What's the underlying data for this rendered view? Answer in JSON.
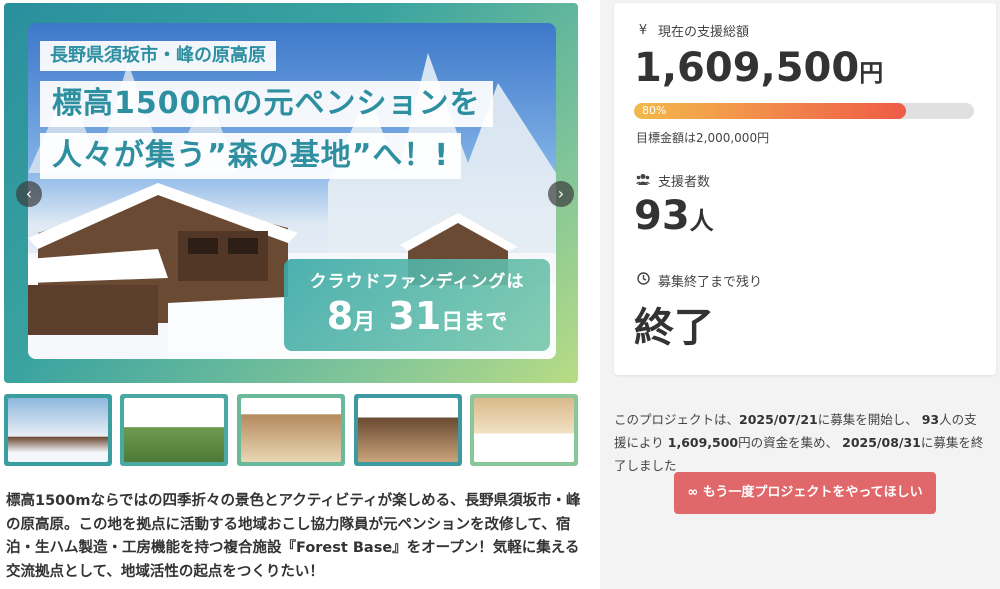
{
  "hero": {
    "caption_line1": "長野県須坂市・峰の原高原",
    "caption_line2": "標高1500ｍの元ペンションを",
    "caption_line3": "人々が集う”森の基地”へ！!",
    "deadline_line1": "クラウドファンディングは",
    "deadline_month": "8",
    "deadline_month_unit": "月",
    "deadline_day": "31",
    "deadline_day_unit": "日まで",
    "prev_icon": "chevron-left-icon",
    "next_icon": "chevron-right-icon"
  },
  "thumbnails": [
    {
      "name": "thumb-1",
      "color": "#3a9e9e"
    },
    {
      "name": "thumb-2",
      "color": "#4aa9a2"
    },
    {
      "name": "thumb-3",
      "color": "#6ab99a"
    },
    {
      "name": "thumb-4",
      "color": "#3d9aa1"
    },
    {
      "name": "thumb-5",
      "color": "#8bc69a"
    }
  ],
  "description": "標高1500mならではの四季折々の景色とアクティビティが楽しめる、長野県須坂市・峰の原高原。この地を拠点に活動する地域おこし協力隊員が元ペンションを改修して、宿泊・生ハム製造・工房機能を持つ複合施設『Forest Base』をオープン！気軽に集える交流拠点として、地域活性の起点をつくりたい！",
  "stats": {
    "total_label": "現在の支援総額",
    "total_icon": "yen-icon",
    "total_amount": "1,609,500",
    "total_unit": "円",
    "progress_percent": 80,
    "progress_label": "80%",
    "goal_text": "目標金額は2,000,000円",
    "supporters_label": "支援者数",
    "supporters_icon": "users-icon",
    "supporters_count": "93",
    "supporters_unit": "人",
    "remaining_label": "募集終了まで残り",
    "remaining_icon": "clock-icon",
    "remaining_value": "終了"
  },
  "summary": {
    "p1": "このプロジェクトは、",
    "start_date": "2025/07/21",
    "p2": "に募集を開始し、",
    "count": "93",
    "p3": "人の支援により",
    "amount": "1,609,500",
    "p4": "円の資金を集め、",
    "end_date": "2025/08/31",
    "p5": "に募集を終了しました"
  },
  "retry_button": {
    "icon": "infinity-icon",
    "label": "もう一度プロジェクトをやってほしい"
  },
  "colors": {
    "accent": "#e0676a",
    "teal": "#2e8fa0",
    "progress_start": "#f3b94b",
    "progress_end": "#ef5b48"
  }
}
